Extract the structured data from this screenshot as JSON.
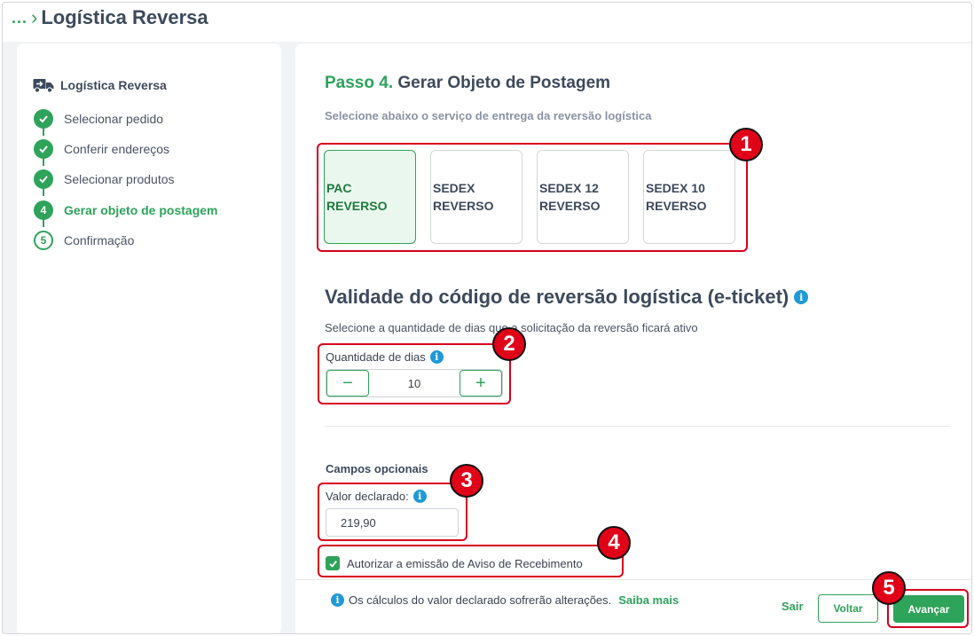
{
  "breadcrumb": {
    "ellipsis": "...",
    "title": "Logística Reversa"
  },
  "sidebar": {
    "title": "Logística Reversa",
    "steps": [
      {
        "label": "Selecionar pedido",
        "status": "done"
      },
      {
        "label": "Conferir endereços",
        "status": "done"
      },
      {
        "label": "Selecionar produtos",
        "status": "done"
      },
      {
        "label": "Gerar objeto de postagem",
        "status": "current",
        "number": "4"
      },
      {
        "label": "Confirmação",
        "status": "todo",
        "number": "5"
      }
    ]
  },
  "main": {
    "step_number": "Passo 4.",
    "step_title": "Gerar Objeto de Postagem",
    "subtitle": "Selecione abaixo o serviço de entrega da reversão logística",
    "services": [
      {
        "label": "PAC\nREVERSO",
        "selected": true
      },
      {
        "label": "SEDEX\nREVERSO",
        "selected": false
      },
      {
        "label": "SEDEX 12\nREVERSO",
        "selected": false
      },
      {
        "label": "SEDEX 10\nREVERSO",
        "selected": false
      }
    ],
    "validity_title": "Validade do código de reversão logística (e-ticket)",
    "validity_desc": "Selecione a quantidade de dias que a solicitação da reversão ficará ativo",
    "qty_label": "Quantidade de dias",
    "qty_value": "10",
    "minus": "−",
    "plus": "+",
    "optional_title": "Campos opcionais",
    "declared_label": "Valor declarado:",
    "declared_value": "219,90",
    "checkbox_label": "Autorizar a emissão de Aviso de Recebimento",
    "checkbox_checked": true
  },
  "footer": {
    "note": "Os cálculos do valor declarado sofrerão alterações.",
    "link": "Saiba mais",
    "sair": "Sair",
    "voltar": "Voltar",
    "avancar": "Avançar"
  },
  "annotations": [
    "1",
    "2",
    "3",
    "4",
    "5"
  ],
  "colors": {
    "accent": "#2ea35a",
    "annotation": "#d8001c",
    "info": "#1e9ad6",
    "text": "#3d4a5c"
  }
}
